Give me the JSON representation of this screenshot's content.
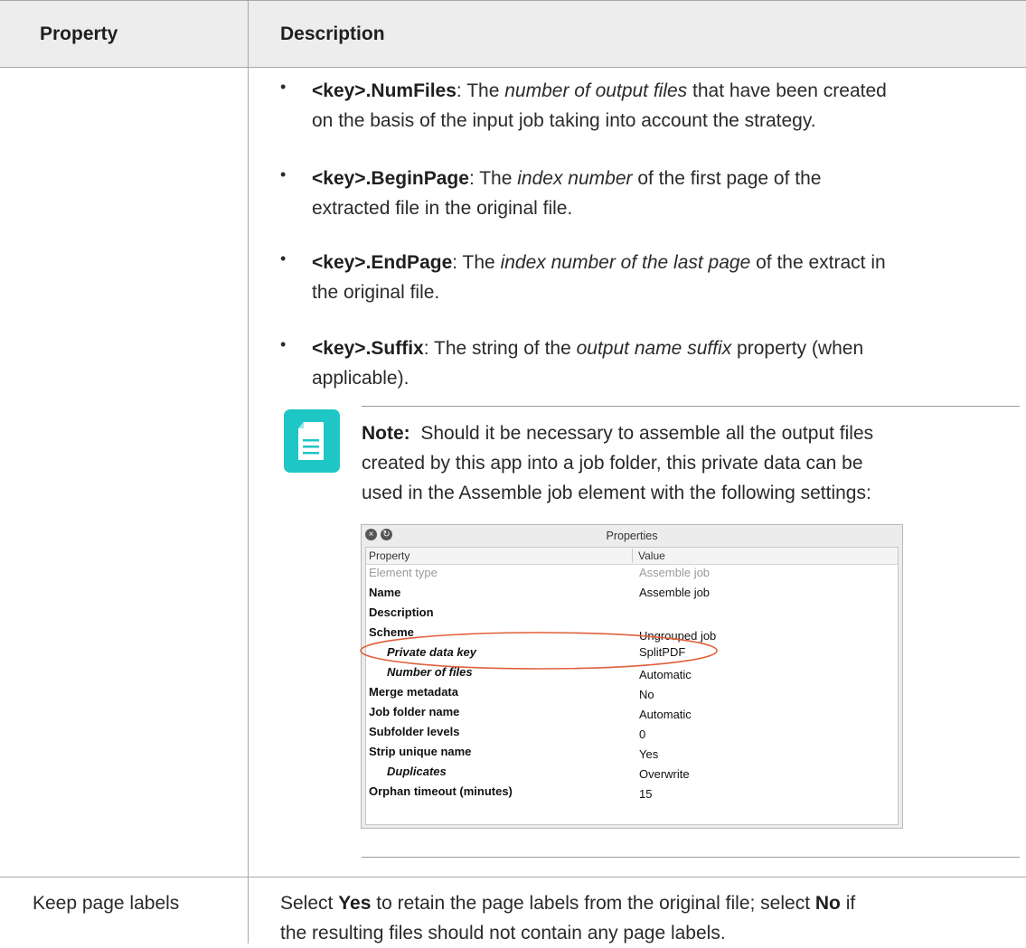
{
  "table": {
    "header": {
      "property": "Property",
      "description": "Description"
    },
    "row1": {
      "bullets": [
        {
          "key": "<key>.NumFiles",
          "parts": [
            ": The ",
            "number of output files",
            " that have been created"
          ],
          "line2": "on the basis of the input job taking into account the strategy."
        },
        {
          "key": "<key>.BeginPage",
          "parts": [
            ": The ",
            "index number",
            " of the first page of the"
          ],
          "line2": "extracted file in the original file."
        },
        {
          "key": "<key>.EndPage",
          "parts": [
            ": The ",
            "index number of the last page",
            " of the extract in"
          ],
          "line2": "the original file."
        },
        {
          "key": "<key>.Suffix",
          "parts": [
            ": The string of the ",
            "output name suffix",
            " property (when"
          ],
          "line2": "applicable)."
        }
      ],
      "note": {
        "label": "Note:",
        "line1": "  Should it be necessary to assemble all the output files",
        "line2": "created by this app into a job folder, this private data can be",
        "line3": "used in the Assemble job element with the following settings:"
      },
      "dialog": {
        "title": "Properties",
        "col_property": "Property",
        "col_value": "Value",
        "rows": [
          {
            "key": "Element type",
            "value": "Assemble job",
            "muted": true,
            "indent": false
          },
          {
            "key": "Name",
            "value": "Assemble job",
            "muted": false,
            "indent": false
          },
          {
            "key": "Description",
            "value": "",
            "muted": false,
            "indent": false
          },
          {
            "key": "Scheme",
            "value": "Ungrouped job",
            "muted": false,
            "indent": false
          },
          {
            "key": "Private data key",
            "value": "SplitPDF",
            "muted": false,
            "indent": true
          },
          {
            "key": "Number of files",
            "value": "Automatic",
            "muted": false,
            "indent": true
          },
          {
            "key": "Merge metadata",
            "value": "No",
            "muted": false,
            "indent": false
          },
          {
            "key": "Job folder name",
            "value": "Automatic",
            "muted": false,
            "indent": false
          },
          {
            "key": "Subfolder levels",
            "value": "0",
            "muted": false,
            "indent": false
          },
          {
            "key": "Strip unique name",
            "value": "Yes",
            "muted": false,
            "indent": false
          },
          {
            "key": "Duplicates",
            "value": "Overwrite",
            "muted": false,
            "indent": true
          },
          {
            "key": "Orphan timeout (minutes)",
            "value": "15",
            "muted": false,
            "indent": false
          }
        ]
      }
    },
    "row2": {
      "property": "Keep page labels",
      "desc": {
        "p1": "Select ",
        "yes": "Yes",
        "p2": " to retain the page labels from the original file; select ",
        "no": "No",
        "p3": " if",
        "line2": "the resulting files should not contain any page labels."
      }
    }
  },
  "colors": {
    "note_icon": "#1ec6c6",
    "highlight_ellipse": "#e0603a",
    "header_bg": "#ededed"
  }
}
